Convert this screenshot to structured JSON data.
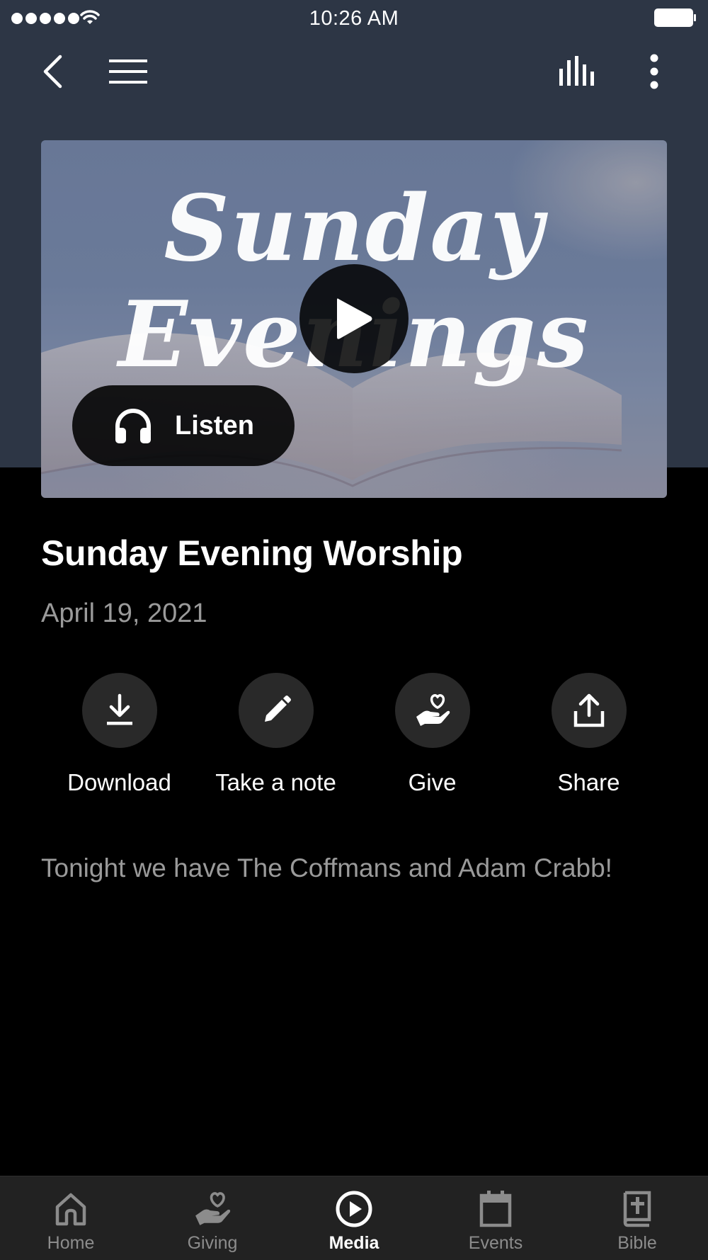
{
  "status_bar": {
    "time": "10:26 AM"
  },
  "header": {
    "back_icon": "chevron-left-icon",
    "menu_icon": "hamburger-icon",
    "audio_icon": "equalizer-icon",
    "more_icon": "vertical-dots-icon"
  },
  "hero": {
    "artwork_text_line1": "Sunday",
    "artwork_text_line2": "Evenings",
    "play_icon": "play-icon",
    "listen_label": "Listen",
    "listen_icon": "headphones-icon"
  },
  "media": {
    "title": "Sunday Evening Worship",
    "date": "April 19, 2021",
    "description": "Tonight we have The Coffmans and Adam Crabb!"
  },
  "actions": [
    {
      "label": "Download",
      "icon": "download-icon"
    },
    {
      "label": "Take a note",
      "icon": "pencil-icon"
    },
    {
      "label": "Give",
      "icon": "giving-hand-icon"
    },
    {
      "label": "Share",
      "icon": "share-icon"
    }
  ],
  "tabs": [
    {
      "label": "Home",
      "icon": "home-icon",
      "active": false
    },
    {
      "label": "Giving",
      "icon": "giving-hand-icon",
      "active": false
    },
    {
      "label": "Media",
      "icon": "play-circle-icon",
      "active": true
    },
    {
      "label": "Events",
      "icon": "calendar-icon",
      "active": false
    },
    {
      "label": "Bible",
      "icon": "bible-icon",
      "active": false
    }
  ],
  "colors": {
    "header_background": "#2d3645",
    "page_background": "#000000",
    "action_circle": "#292929",
    "secondary_text": "#9a9a9a",
    "tab_bar": "#222222"
  }
}
